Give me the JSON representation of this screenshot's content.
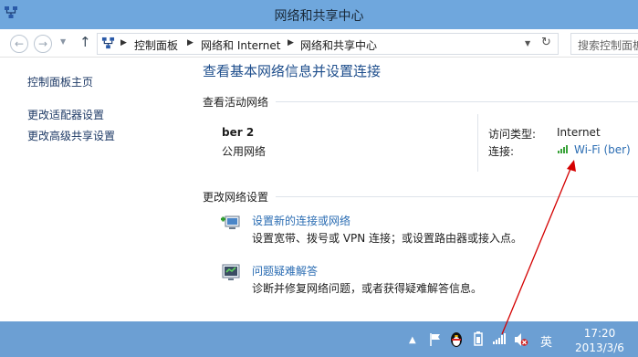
{
  "window": {
    "title": "网络和共享中心"
  },
  "navbar": {
    "breadcrumbs": [
      "控制面板",
      "网络和 Internet",
      "网络和共享中心"
    ],
    "search_placeholder": "搜索控制面板"
  },
  "sidebar": {
    "items": [
      {
        "label": "控制面板主页"
      },
      {
        "label": "更改适配器设置"
      },
      {
        "label": "更改高级共享设置"
      }
    ]
  },
  "main": {
    "title": "查看基本网络信息并设置连接",
    "active_networks_heading": "查看活动网络",
    "network": {
      "name": "ber  2",
      "category": "公用网络",
      "access_type_label": "访问类型:",
      "access_type_value": "Internet",
      "connections_label": "连接:",
      "connection_value": "Wi-Fi (ber)"
    },
    "change_settings_heading": "更改网络设置",
    "tasks": [
      {
        "link": "设置新的连接或网络",
        "desc": "设置宽带、拨号或 VPN 连接；或设置路由器或接入点。"
      },
      {
        "link": "问题疑难解答",
        "desc": "诊断并修复网络问题，或者获得疑难解答信息。"
      }
    ]
  },
  "taskbar": {
    "tray_icons": [
      "up-arrow-icon",
      "flag-icon",
      "qq-penguin-icon",
      "power-plug-icon",
      "wifi-signal-icon",
      "volume-muted-icon"
    ],
    "ime_label": "英",
    "time": "17:20",
    "date": "2013/3/6"
  },
  "colors": {
    "titlebar": "#6fa7dd",
    "taskbar": "#6c9fd3",
    "link": "#2b6db3",
    "heading": "#1e4e8c",
    "annotation_arrow": "#d40000"
  }
}
